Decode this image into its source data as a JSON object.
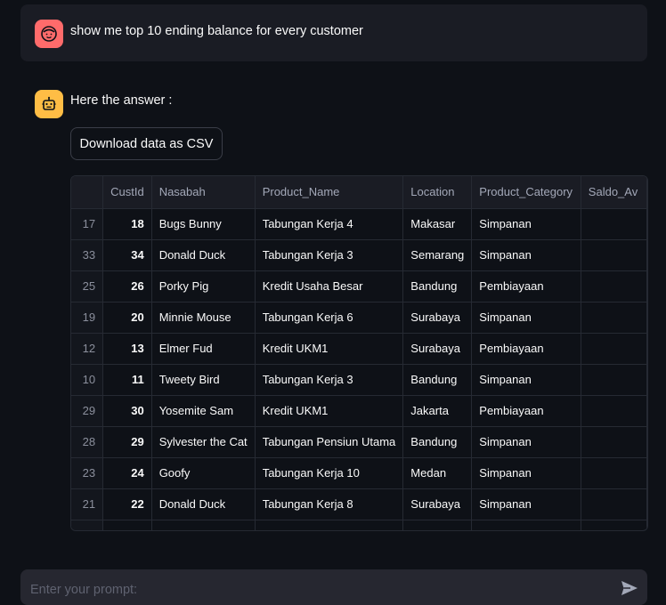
{
  "user_message": {
    "text": "show me top 10 ending balance for every customer",
    "avatar_icon": "user-face-icon",
    "avatar_color": "#ff6b6b"
  },
  "assistant_message": {
    "text": "Here the answer :",
    "avatar_icon": "bot-icon",
    "avatar_color": "#ffbd45"
  },
  "download_button": {
    "label": "Download data as CSV"
  },
  "table": {
    "columns": [
      "",
      "CustId",
      "Nasabah",
      "Product_Name",
      "Location",
      "Product_Category",
      "Saldo_Av"
    ],
    "rows": [
      [
        "17",
        "18",
        "Bugs Bunny",
        "Tabungan Kerja 4",
        "Makasar",
        "Simpanan",
        ""
      ],
      [
        "33",
        "34",
        "Donald Duck",
        "Tabungan Kerja 3",
        "Semarang",
        "Simpanan",
        ""
      ],
      [
        "25",
        "26",
        "Porky Pig",
        "Kredit Usaha Besar",
        "Bandung",
        "Pembiayaan",
        ""
      ],
      [
        "19",
        "20",
        "Minnie Mouse",
        "Tabungan Kerja 6",
        "Surabaya",
        "Simpanan",
        ""
      ],
      [
        "12",
        "13",
        "Elmer Fud",
        "Kredit UKM1",
        "Surabaya",
        "Pembiayaan",
        ""
      ],
      [
        "10",
        "11",
        "Tweety Bird",
        "Tabungan Kerja 3",
        "Bandung",
        "Simpanan",
        ""
      ],
      [
        "29",
        "30",
        "Yosemite Sam",
        "Kredit UKM1",
        "Jakarta",
        "Pembiayaan",
        ""
      ],
      [
        "28",
        "29",
        "Sylvester the Cat",
        "Tabungan Pensiun Utama",
        "Bandung",
        "Simpanan",
        ""
      ],
      [
        "23",
        "24",
        "Goofy",
        "Tabungan Kerja 10",
        "Medan",
        "Simpanan",
        ""
      ],
      [
        "21",
        "22",
        "Donald Duck",
        "Tabungan Kerja 8",
        "Surabaya",
        "Simpanan",
        ""
      ]
    ]
  },
  "prompt_input": {
    "placeholder": "Enter your prompt:",
    "value": ""
  },
  "send_icon": "send-icon"
}
